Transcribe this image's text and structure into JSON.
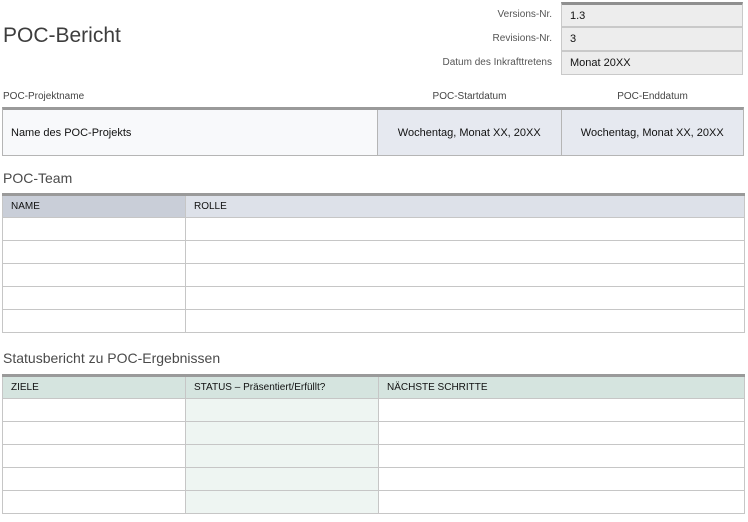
{
  "header": {
    "title": "POC-Bericht",
    "version_label": "Versions-Nr.",
    "version_value": "1.3",
    "revision_label": "Revisions-Nr.",
    "revision_value": "3",
    "date_label": "Datum des Inkrafttretens",
    "date_value": "Monat 20XX"
  },
  "project": {
    "name_label": "POC-Projektname",
    "start_label": "POC-Startdatum",
    "end_label": "POC-Enddatum",
    "name_value": "Name des POC-Projekts",
    "start_value": "Wochentag, Monat XX, 20XX",
    "end_value": "Wochentag, Monat XX, 20XX"
  },
  "team": {
    "title": "POC-Team",
    "columns": [
      "NAME",
      "ROLLE"
    ],
    "rows": [
      [
        "",
        ""
      ],
      [
        "",
        ""
      ],
      [
        "",
        ""
      ],
      [
        "",
        ""
      ],
      [
        "",
        ""
      ]
    ]
  },
  "status": {
    "title": "Statusbericht zu POC-Ergebnissen",
    "columns": [
      "ZIELE",
      "STATUS – Präsentiert/Erfüllt?",
      "NÄCHSTE SCHRITTE"
    ],
    "rows": [
      [
        "",
        "",
        ""
      ],
      [
        "",
        "",
        ""
      ],
      [
        "",
        "",
        ""
      ],
      [
        "",
        "",
        ""
      ],
      [
        "",
        "",
        ""
      ]
    ]
  }
}
